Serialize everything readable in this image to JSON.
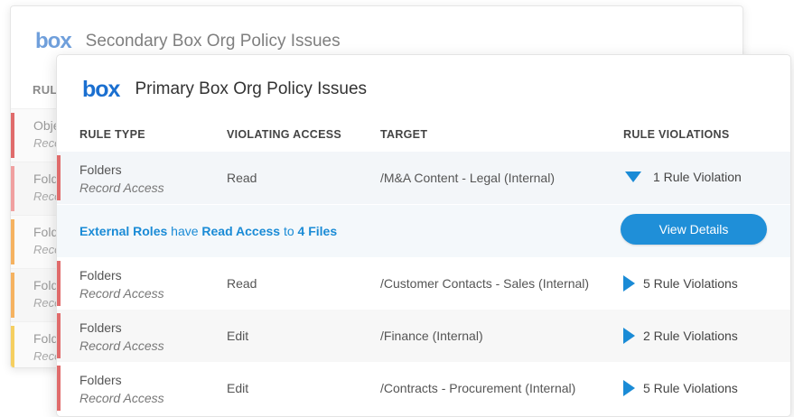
{
  "secondary": {
    "logo": "box",
    "title": "Secondary Box Org Policy Issues",
    "column_header": "RULI",
    "rows": [
      {
        "line1": "Obje",
        "line2": "Reco",
        "color": "#e06b6b"
      },
      {
        "line1": "Fold",
        "line2": "Reco",
        "color": "#f0a0a0"
      },
      {
        "line1": "Fold",
        "line2": "Reco",
        "color": "#f5b260"
      },
      {
        "line1": "Fold",
        "line2": "Reco",
        "color": "#f5b260"
      },
      {
        "line1": "Fold",
        "line2": "Reco",
        "color": "#f5cf60"
      }
    ]
  },
  "primary": {
    "logo": "box",
    "title": "Primary Box Org Policy Issues",
    "columns": [
      "RULE TYPE",
      "VIOLATING ACCESS",
      "TARGET",
      "RULE VIOLATIONS"
    ],
    "rows": [
      {
        "type": "Folders",
        "subtype": "Record Access",
        "access": "Read",
        "target": "/M&A Content - Legal (Internal)",
        "violations": "1 Rule Violation",
        "expanded": true
      },
      {
        "type": "Folders",
        "subtype": "Record Access",
        "access": "Read",
        "target": "/Customer Contacts - Sales (Internal)",
        "violations": "5 Rule Violations",
        "expanded": false
      },
      {
        "type": "Folders",
        "subtype": "Record Access",
        "access": "Edit",
        "target": "/Finance (Internal)",
        "violations": "2 Rule Violations",
        "expanded": false
      },
      {
        "type": "Folders",
        "subtype": "Record Access",
        "access": "Edit",
        "target": "/Contracts - Procurement (Internal)",
        "violations": "5 Rule Violations",
        "expanded": false
      }
    ],
    "detail": {
      "part1": "External Roles",
      "part2": " have ",
      "part3": "Read Access",
      "part4": " to ",
      "part5": "4 Files",
      "button": "View Details"
    }
  },
  "colors": {
    "accent": "#1f8fd8",
    "link": "#1a8bd6",
    "logo": "#1a6fd0",
    "severity_high": "#e06b6b"
  }
}
